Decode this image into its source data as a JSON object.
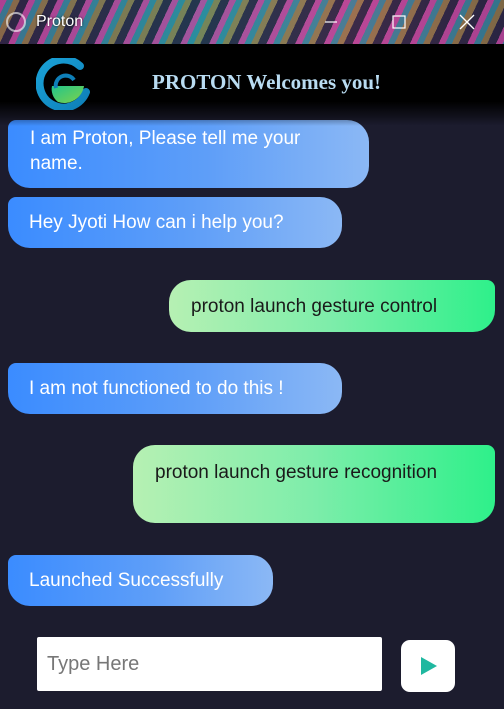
{
  "window": {
    "title": "Proton",
    "icons": {
      "app": "app-logo-icon",
      "minimize": "minimize-icon",
      "maximize": "maximize-icon",
      "close": "close-icon"
    }
  },
  "header": {
    "title": "PROTON Welcomes you!",
    "logo_icon": "proton-logo-icon"
  },
  "messages": [
    {
      "sender": "bot",
      "text": "I am Proton, Please tell me your name."
    },
    {
      "sender": "bot",
      "text": "Hey Jyoti How can i help you?"
    },
    {
      "sender": "user",
      "text": "proton launch gesture control"
    },
    {
      "sender": "bot",
      "text": "I am not functioned to do this !"
    },
    {
      "sender": "user",
      "text": "proton launch gesture recognition"
    },
    {
      "sender": "bot",
      "text": "Launched Successfully"
    }
  ],
  "composer": {
    "placeholder": "Type Here",
    "value": "",
    "send_icon": "send-play-icon"
  },
  "colors": {
    "background": "#1c1c2e",
    "bot_bubble": "#3b8cff",
    "user_bubble": "#2ef08a",
    "header_text": "#b9dcf2",
    "send_icon": "#1fb8a0"
  }
}
